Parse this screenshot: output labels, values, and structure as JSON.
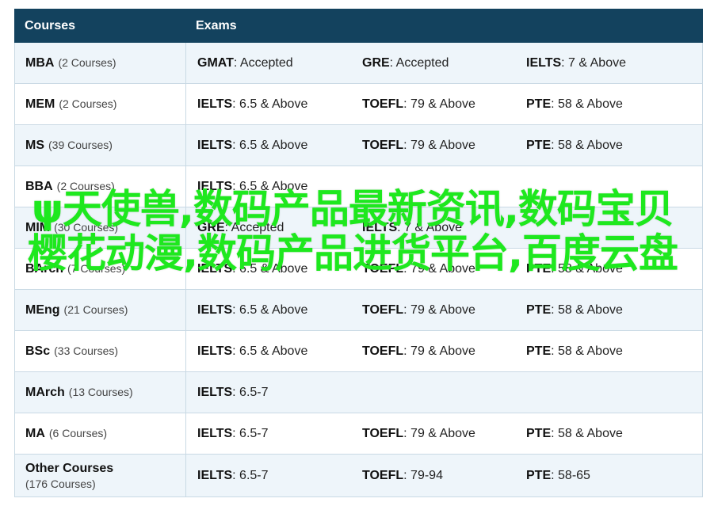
{
  "header": {
    "courses": "Courses",
    "exams": "Exams"
  },
  "rows": [
    {
      "name": "MBA",
      "count": "(2 Courses)",
      "exams": [
        {
          "name": "GMAT",
          "value": ": Accepted"
        },
        {
          "name": "GRE",
          "value": ": Accepted"
        },
        {
          "name": "IELTS",
          "value": ": 7 & Above"
        }
      ]
    },
    {
      "name": "MEM",
      "count": "(2 Courses)",
      "exams": [
        {
          "name": "IELTS",
          "value": ": 6.5 & Above"
        },
        {
          "name": "TOEFL",
          "value": ": 79 & Above"
        },
        {
          "name": "PTE",
          "value": ": 58 & Above"
        }
      ]
    },
    {
      "name": "MS",
      "count": "(39 Courses)",
      "exams": [
        {
          "name": "IELTS",
          "value": ": 6.5 & Above"
        },
        {
          "name": "TOEFL",
          "value": ": 79 & Above"
        },
        {
          "name": "PTE",
          "value": ": 58 & Above"
        }
      ]
    },
    {
      "name": "BBA",
      "count": "(2 Courses)",
      "exams": [
        {
          "name": "IELTS",
          "value": ": 6.5 & Above"
        }
      ]
    },
    {
      "name": "MIM",
      "count": "(30 Courses)",
      "exams": [
        {
          "name": "GRE",
          "value": ": Accepted"
        },
        {
          "name": "IELTS",
          "value": ": 7 & Above"
        }
      ]
    },
    {
      "name": "BArch",
      "count": "(7 Courses)",
      "exams": [
        {
          "name": "IELTS",
          "value": ": 6.5 & Above"
        },
        {
          "name": "TOEFL",
          "value": ": 79 & Above"
        },
        {
          "name": "PTE",
          "value": ": 58 & Above"
        }
      ]
    },
    {
      "name": "MEng",
      "count": "(21 Courses)",
      "exams": [
        {
          "name": "IELTS",
          "value": ": 6.5 & Above"
        },
        {
          "name": "TOEFL",
          "value": ": 79 & Above"
        },
        {
          "name": "PTE",
          "value": ": 58 & Above"
        }
      ]
    },
    {
      "name": "BSc",
      "count": "(33 Courses)",
      "exams": [
        {
          "name": "IELTS",
          "value": ": 6.5 & Above"
        },
        {
          "name": "TOEFL",
          "value": ": 79 & Above"
        },
        {
          "name": "PTE",
          "value": ": 58 & Above"
        }
      ]
    },
    {
      "name": "MArch",
      "count": "(13 Courses)",
      "exams": [
        {
          "name": "IELTS",
          "value": ": 6.5-7"
        }
      ]
    },
    {
      "name": "MA",
      "count": "(6 Courses)",
      "exams": [
        {
          "name": "IELTS",
          "value": ": 6.5-7"
        },
        {
          "name": "TOEFL",
          "value": ": 79 & Above"
        },
        {
          "name": "PTE",
          "value": ": 58 & Above"
        }
      ]
    },
    {
      "name": "Other Courses",
      "count": "(176 Courses)",
      "exams": [
        {
          "name": "IELTS",
          "value": ": 6.5-7"
        },
        {
          "name": "TOEFL",
          "value": ": 79-94"
        },
        {
          "name": "PTE",
          "value": ": 58-65"
        }
      ]
    }
  ],
  "overlay_text": "ψ天使兽,数码产品最新资讯,数码宝贝樱花动漫,数码产品进货平台,百度云盘",
  "colors": {
    "header_bg": "#13425e",
    "row_alt_bg": "#eef5fa",
    "border": "#c9d9e4",
    "overlay": "#1ee81e"
  }
}
